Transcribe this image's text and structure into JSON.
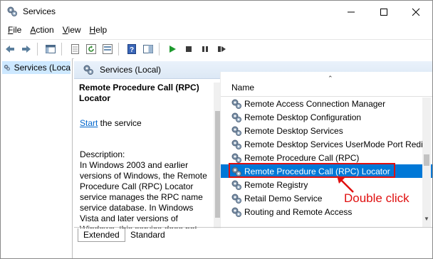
{
  "window": {
    "title": "Services"
  },
  "menu": [
    {
      "underline": "F",
      "rest": "ile"
    },
    {
      "underline": "A",
      "rest": "ction"
    },
    {
      "underline": "V",
      "rest": "iew"
    },
    {
      "underline": "H",
      "rest": "elp"
    }
  ],
  "tree": {
    "item_label": "Services (Loca"
  },
  "pane": {
    "header": "Services (Local)",
    "desc_title": "Remote Procedure Call (RPC) Locator",
    "start_link": "Start",
    "start_rest": " the service",
    "description": "Description:\nIn Windows 2003 and earlier versions of Windows, the Remote Procedure Call (RPC) Locator service manages the RPC name service database. In Windows Vista and later versions of Windows, this service does not provide"
  },
  "list": {
    "column_name": "Name",
    "rows": [
      "Remote Access Connection Manager",
      "Remote Desktop Configuration",
      "Remote Desktop Services",
      "Remote Desktop Services UserMode Port Redire",
      "Remote Procedure Call (RPC)",
      "Remote Procedure Call (RPC) Locator",
      "Remote Registry",
      "Retail Demo Service",
      "Routing and Remote Access"
    ],
    "selected_index": 5
  },
  "annotation": {
    "label": "Double click",
    "color": "#e01010"
  },
  "tabs": {
    "extended": "Extended",
    "standard": "Standard"
  },
  "colors": {
    "selection": "#0078d7",
    "link": "#0066cc"
  }
}
